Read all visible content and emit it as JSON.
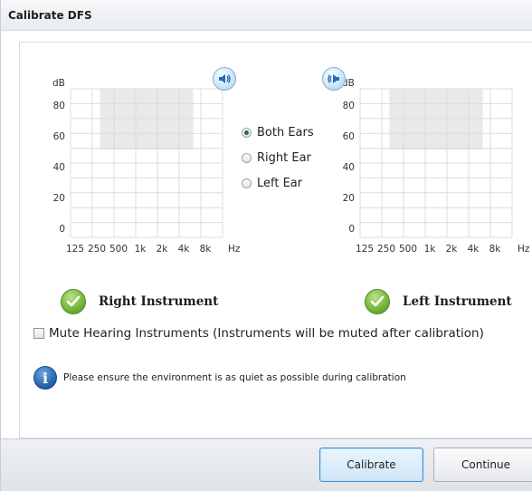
{
  "window": {
    "title": "Calibrate DFS"
  },
  "right_chart": {
    "y_unit": "dB",
    "y_ticks": [
      "80",
      "60",
      "40",
      "20",
      "0"
    ],
    "x_ticks": [
      "125",
      "250",
      "500",
      "1k",
      "2k",
      "4k",
      "8k"
    ],
    "x_unit": "Hz"
  },
  "left_chart": {
    "y_unit": "dB",
    "y_ticks": [
      "80",
      "60",
      "40",
      "20",
      "0"
    ],
    "x_ticks": [
      "125",
      "250",
      "500",
      "1k",
      "2k",
      "4k",
      "8k"
    ],
    "x_unit": "Hz"
  },
  "icons": {
    "right_speaker": "speaker-right-icon",
    "left_speaker": "speaker-left-icon",
    "check": "check-icon",
    "info": "info-icon"
  },
  "ear_options": [
    {
      "label": "Both Ears",
      "selected": true
    },
    {
      "label": "Right Ear",
      "selected": false
    },
    {
      "label": "Left Ear",
      "selected": false
    }
  ],
  "instruments": {
    "right_label": "Right Instrument",
    "left_label": "Left Instrument"
  },
  "mute": {
    "label": "Mute Hearing Instruments (Instruments will be muted after calibration)",
    "checked": false
  },
  "info_message": "Please ensure the environment is as quiet as possible during calibration",
  "buttons": {
    "calibrate": "Calibrate",
    "continue": "Continue"
  },
  "colors": {
    "accent": "#3c8fd6",
    "success": "#6aa935",
    "info": "#2a66b0"
  }
}
